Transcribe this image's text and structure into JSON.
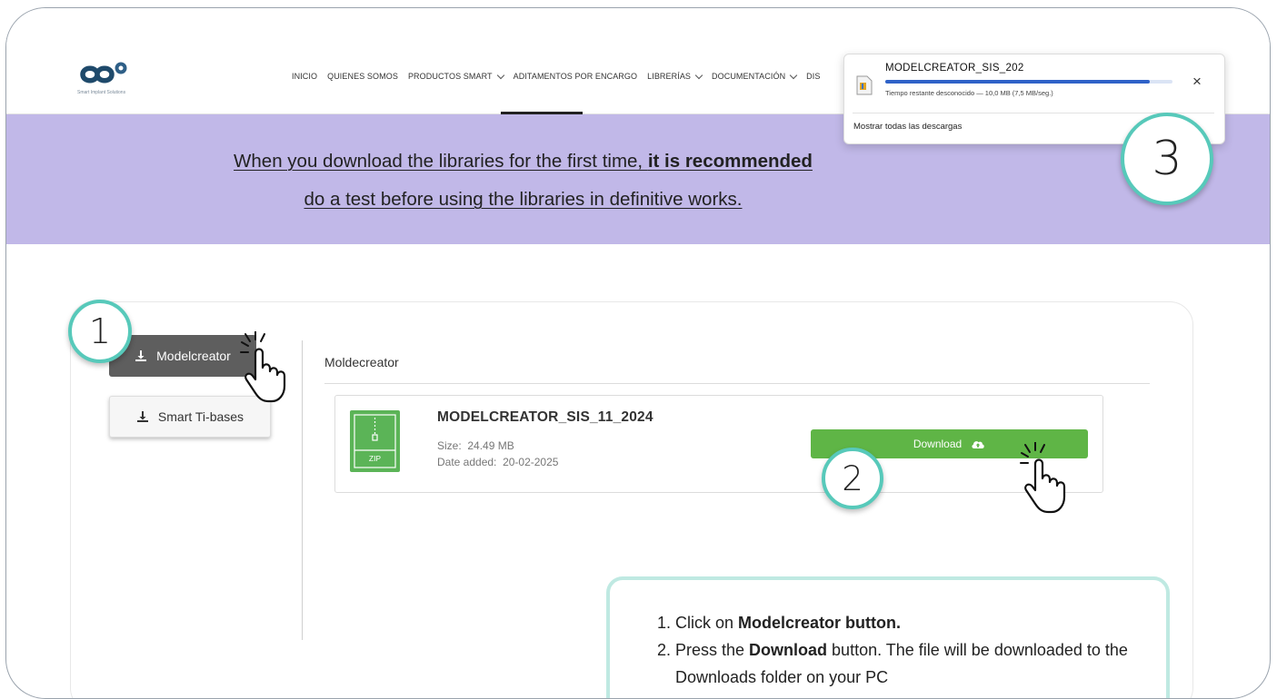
{
  "header": {
    "logo_subtitle": "Smart Implant Solutions",
    "nav": [
      {
        "label": "INICIO",
        "dropdown": false
      },
      {
        "label": "QUIENES SOMOS",
        "dropdown": false
      },
      {
        "label": "PRODUCTOS SMART",
        "dropdown": true
      },
      {
        "label": "ADITAMENTOS POR ENCARGO",
        "dropdown": false
      },
      {
        "label": "LIBRERÍAS",
        "dropdown": true
      },
      {
        "label": "DOCUMENTACIÓN",
        "dropdown": true
      },
      {
        "label": "DIS",
        "dropdown": false
      }
    ]
  },
  "banner": {
    "line1_plain": "When you download the libraries for the first time, ",
    "line1_bold": "it is recommended",
    "line2": "do a test before using the libraries in definitive works."
  },
  "download_popup": {
    "file_name": "MODELCREATOR_SIS_202",
    "progress": 0.92,
    "status": "Tiempo restante desconocido — 10,0 MB (7,5 MB/seg.)",
    "close_glyph": "×",
    "show_all": "Mostrar todas las descargas"
  },
  "steps": [
    "1",
    "2",
    "3"
  ],
  "sidebar": {
    "buttons": [
      {
        "label": "Modelcreator",
        "active": true
      },
      {
        "label": "Smart Ti-bases",
        "active": false
      }
    ]
  },
  "section": {
    "title": "Moldecreator",
    "file": {
      "name": "MODELCREATOR_SIS_11_2024",
      "type_label": "ZIP",
      "size_label": "Size:",
      "size_value": "24.49 MB",
      "date_label": "Date added:",
      "date_value": "20-02-2025",
      "download_label": "Download"
    }
  },
  "instructions": {
    "items": [
      {
        "num": "1.",
        "pre": "Click on ",
        "bold": "Modelcreator button.",
        "post": ""
      },
      {
        "num": "2.",
        "pre": "Press the ",
        "bold": "Download",
        "post": " button. The file will be downloaded to the Downloads folder on your PC"
      }
    ]
  },
  "colors": {
    "banner": "#c1b8e8",
    "accent_teal": "#57c9ba",
    "download_green": "#5fb546",
    "progress_blue": "#2f62c8",
    "active_button": "#5e5e5e"
  },
  "icons": [
    "logo-infinity-icon",
    "download-tray-icon",
    "zip-file-icon",
    "cloud-upload-icon",
    "pointing-hand-icon",
    "close-icon",
    "chevron-down-icon",
    "file-icon"
  ]
}
